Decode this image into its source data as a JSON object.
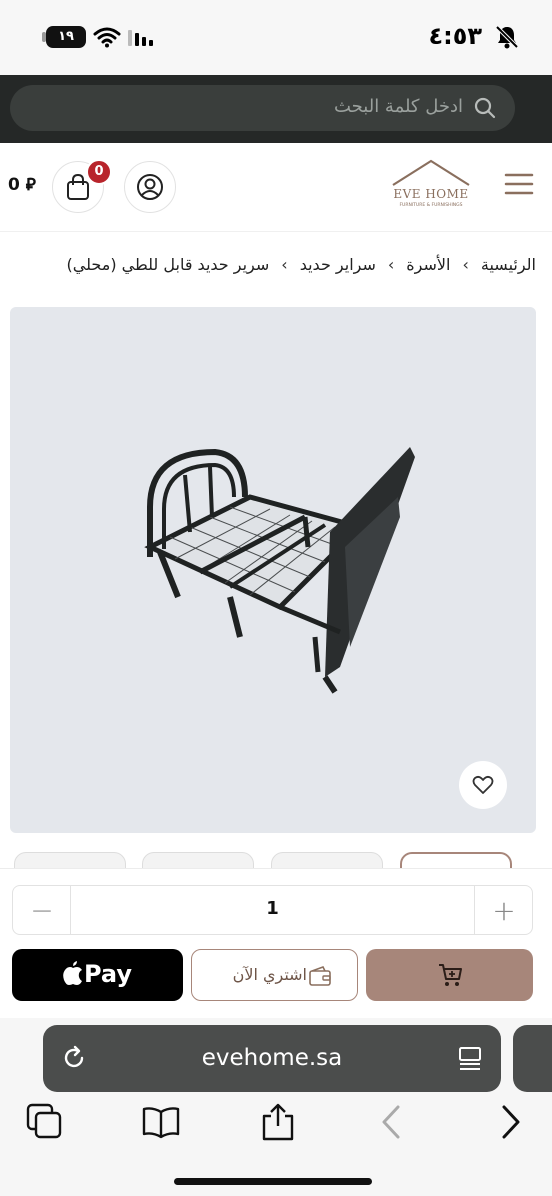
{
  "status_bar": {
    "time": "٤:٥٣",
    "battery": "١٩"
  },
  "search": {
    "placeholder": "ادخل كلمة البحث"
  },
  "header": {
    "logo_text": "EVE HOME",
    "logo_subtext": "FURNITURE & FURNISHINGS",
    "cart_count": "0",
    "cart_total": "0 ⃁"
  },
  "breadcrumb": [
    "الرئيسية",
    "الأسرة",
    "سراير حديد",
    "سرير حديد قابل للطي (محلي)"
  ],
  "breadcrumb_separator": "‹",
  "purchase": {
    "minus": "−",
    "plus": "+",
    "quantity": "1",
    "apple_pay": "Pay",
    "buy_now": "اشتري الآن"
  },
  "browser": {
    "url": "evehome.sa"
  },
  "colors": {
    "accent": "#a7867a",
    "badge": "#b8242b",
    "dark_band": "#252827",
    "image_bg": "#e4e7ec"
  }
}
